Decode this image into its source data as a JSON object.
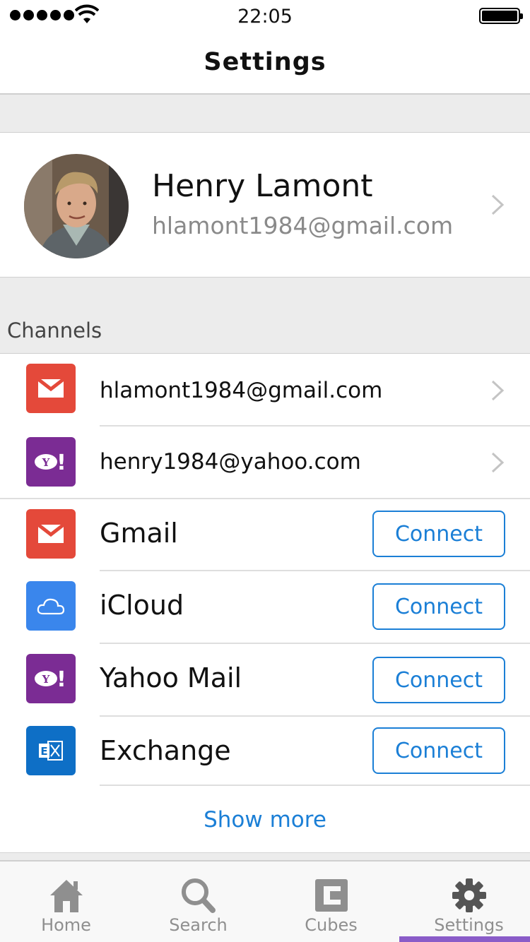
{
  "status_bar": {
    "time": "22:05"
  },
  "nav": {
    "title": "Settings"
  },
  "profile": {
    "name": "Henry Lamont",
    "email": "hlamont1984@gmail.com"
  },
  "channels": {
    "section_label": "Channels",
    "connected": [
      {
        "email": "hlamont1984@gmail.com",
        "service_icon": "gmail-icon"
      },
      {
        "email": "henry1984@yahoo.com",
        "service_icon": "yahoo-icon"
      }
    ],
    "available": [
      {
        "name": "Gmail",
        "service_icon": "gmail-icon",
        "button": "Connect"
      },
      {
        "name": "iCloud",
        "service_icon": "icloud-icon",
        "button": "Connect"
      },
      {
        "name": "Yahoo Mail",
        "service_icon": "yahoo-icon",
        "button": "Connect"
      },
      {
        "name": "Exchange",
        "service_icon": "exchange-icon",
        "button": "Connect"
      }
    ],
    "show_more": "Show more"
  },
  "tabs": [
    {
      "label": "Home",
      "icon": "home-icon"
    },
    {
      "label": "Search",
      "icon": "search-icon"
    },
    {
      "label": "Cubes",
      "icon": "cubes-icon"
    },
    {
      "label": "Settings",
      "icon": "gear-icon",
      "active": true
    }
  ],
  "colors": {
    "accent": "#1b7fd6",
    "gmail": "#e4493a",
    "yahoo": "#7b2c94",
    "icloud": "#3a86ec",
    "exchange": "#0e6fc6",
    "tab_indicator": "#8a5cc8"
  }
}
